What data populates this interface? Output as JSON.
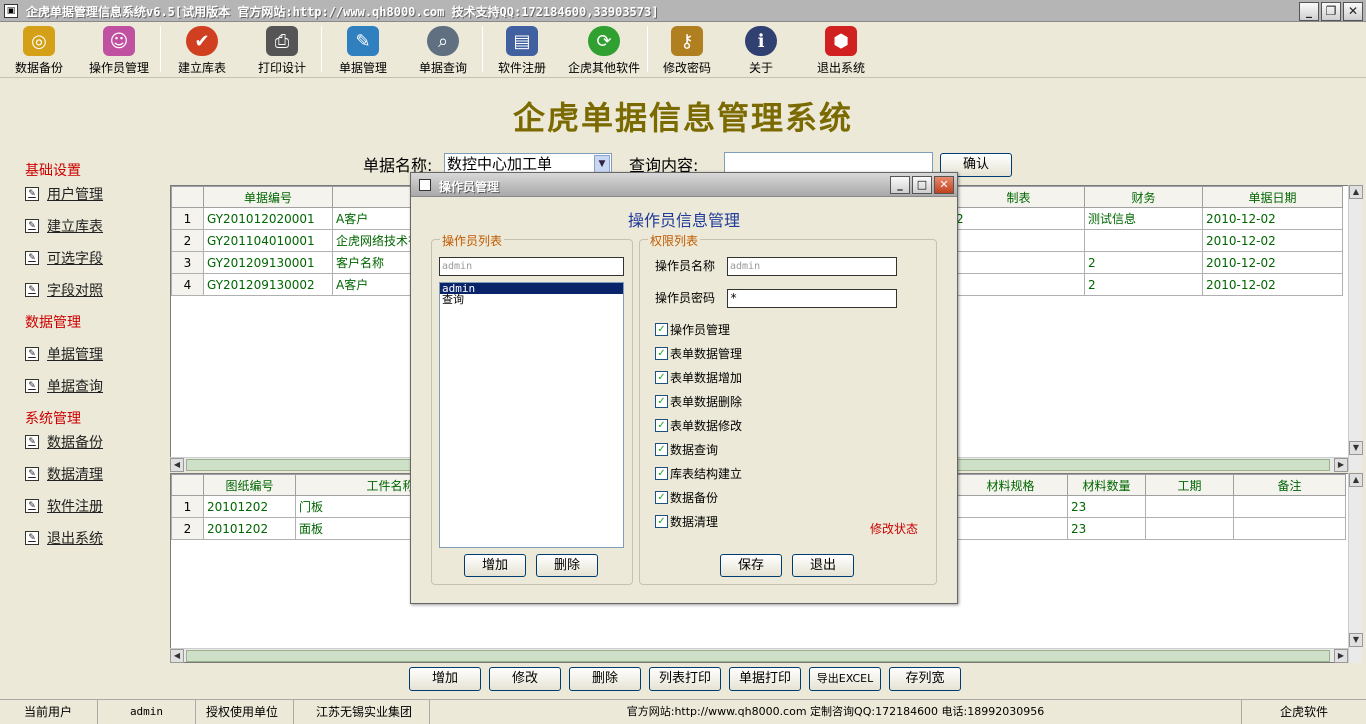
{
  "window": {
    "title": "企虎单据管理信息系统v6.5[试用版本 官方网站:http://www.qh8000.com 技术支持QQ:172184600,33903573]",
    "min": "_",
    "max": "❐",
    "close": "✕"
  },
  "toolbar": {
    "items": [
      {
        "label": "数据备份",
        "icon": "database-backup-icon",
        "color": "#d4a017"
      },
      {
        "label": "操作员管理",
        "icon": "operator-icon",
        "color": "#c050a0"
      },
      {
        "label": "建立库表",
        "icon": "build-table-icon",
        "color": "#d04020"
      },
      {
        "label": "打印设计",
        "icon": "printer-icon",
        "color": "#555555"
      },
      {
        "label": "单据管理",
        "icon": "document-manage-icon",
        "color": "#3080c0"
      },
      {
        "label": "单据查询",
        "icon": "magnifier-icon",
        "color": "#607080"
      },
      {
        "label": "软件注册",
        "icon": "register-icon",
        "color": "#4060a0"
      },
      {
        "label": "企虎其他软件",
        "icon": "refresh-icon",
        "color": "#30a030"
      },
      {
        "label": "修改密码",
        "icon": "key-icon",
        "color": "#b08020"
      },
      {
        "label": "关于",
        "icon": "about-icon",
        "color": "#304070"
      },
      {
        "label": "退出系统",
        "icon": "exit-icon",
        "color": "#d02020"
      }
    ]
  },
  "banner": {
    "title": "企虎单据信息管理系统"
  },
  "sidebar": {
    "sections": [
      {
        "title": "基础设置",
        "items": [
          "用户管理",
          "建立库表",
          "可选字段",
          "字段对照"
        ]
      },
      {
        "title": "数据管理",
        "items": [
          "单据管理",
          "单据查询"
        ]
      },
      {
        "title": "系统管理",
        "items": [
          "数据备份",
          "数据清理",
          "软件注册",
          "退出系统"
        ]
      }
    ]
  },
  "search": {
    "doc_name_label": "单据名称:",
    "doc_name_value": "数控中心加工单",
    "query_label": "查询内容:",
    "query_value": "",
    "confirm": "确认"
  },
  "top_grid": {
    "headers": [
      "",
      "单据编号",
      "",
      "",
      "",
      "",
      "",
      "",
      "制表",
      "财务",
      "单据日期"
    ],
    "rows": [
      {
        "num": "1",
        "id": "GY201012020001",
        "client": "A客户",
        "maker": "2",
        "finance": "测试信息",
        "date": "2010-12-02"
      },
      {
        "num": "2",
        "id": "GY201104010001",
        "client": "企虎网络技术有",
        "maker": "",
        "finance": "",
        "date": "2010-12-02"
      },
      {
        "num": "3",
        "id": "GY201209130001",
        "client": "客户名称",
        "maker": "",
        "finance": "2",
        "date": "2010-12-02"
      },
      {
        "num": "4",
        "id": "GY201209130002",
        "client": "A客户",
        "maker": "",
        "finance": "2",
        "date": "2010-12-02"
      }
    ]
  },
  "bottom_grid": {
    "headers": [
      "",
      "图纸编号",
      "工件名称",
      "",
      "",
      "",
      "",
      "材料规格",
      "材料数量",
      "工期",
      "备注"
    ],
    "rows": [
      {
        "num": "1",
        "drawing": "20101202",
        "part": "门板",
        "spec": "",
        "qty": "23",
        "period": "",
        "note": ""
      },
      {
        "num": "2",
        "drawing": "20101202",
        "part": "面板",
        "spec": "",
        "qty": "23",
        "period": "",
        "note": ""
      }
    ]
  },
  "bottom_buttons": [
    "增加",
    "修改",
    "删除",
    "列表打印",
    "单据打印",
    "导出EXCEL",
    "存列宽"
  ],
  "statusbar": {
    "user_label": "当前用户",
    "user": "admin",
    "licensee_label": "授权使用单位",
    "licensee": "江苏无锡实业集团",
    "site": "官方网站:http://www.qh8000.com 定制咨询QQ:172184600 电话:18992030956",
    "brand": "企虎软件"
  },
  "dialog": {
    "title": "操作员管理",
    "heading": "操作员信息管理",
    "operator_list_legend": "操作员列表",
    "operator_filter": "admin",
    "operators": [
      "admin",
      "查询"
    ],
    "selected_operator": 0,
    "add": "增加",
    "delete": "删除",
    "perm_legend": "权限列表",
    "name_label": "操作员名称",
    "name_value": "admin",
    "password_label": "操作员密码",
    "password_value": "*",
    "permissions": [
      "操作员管理",
      "表单数据管理",
      "表单数据增加",
      "表单数据删除",
      "表单数据修改",
      "数据查询",
      "库表结构建立",
      "数据备份",
      "数据清理"
    ],
    "mode": "修改状态",
    "save": "保存",
    "exit": "退出"
  }
}
